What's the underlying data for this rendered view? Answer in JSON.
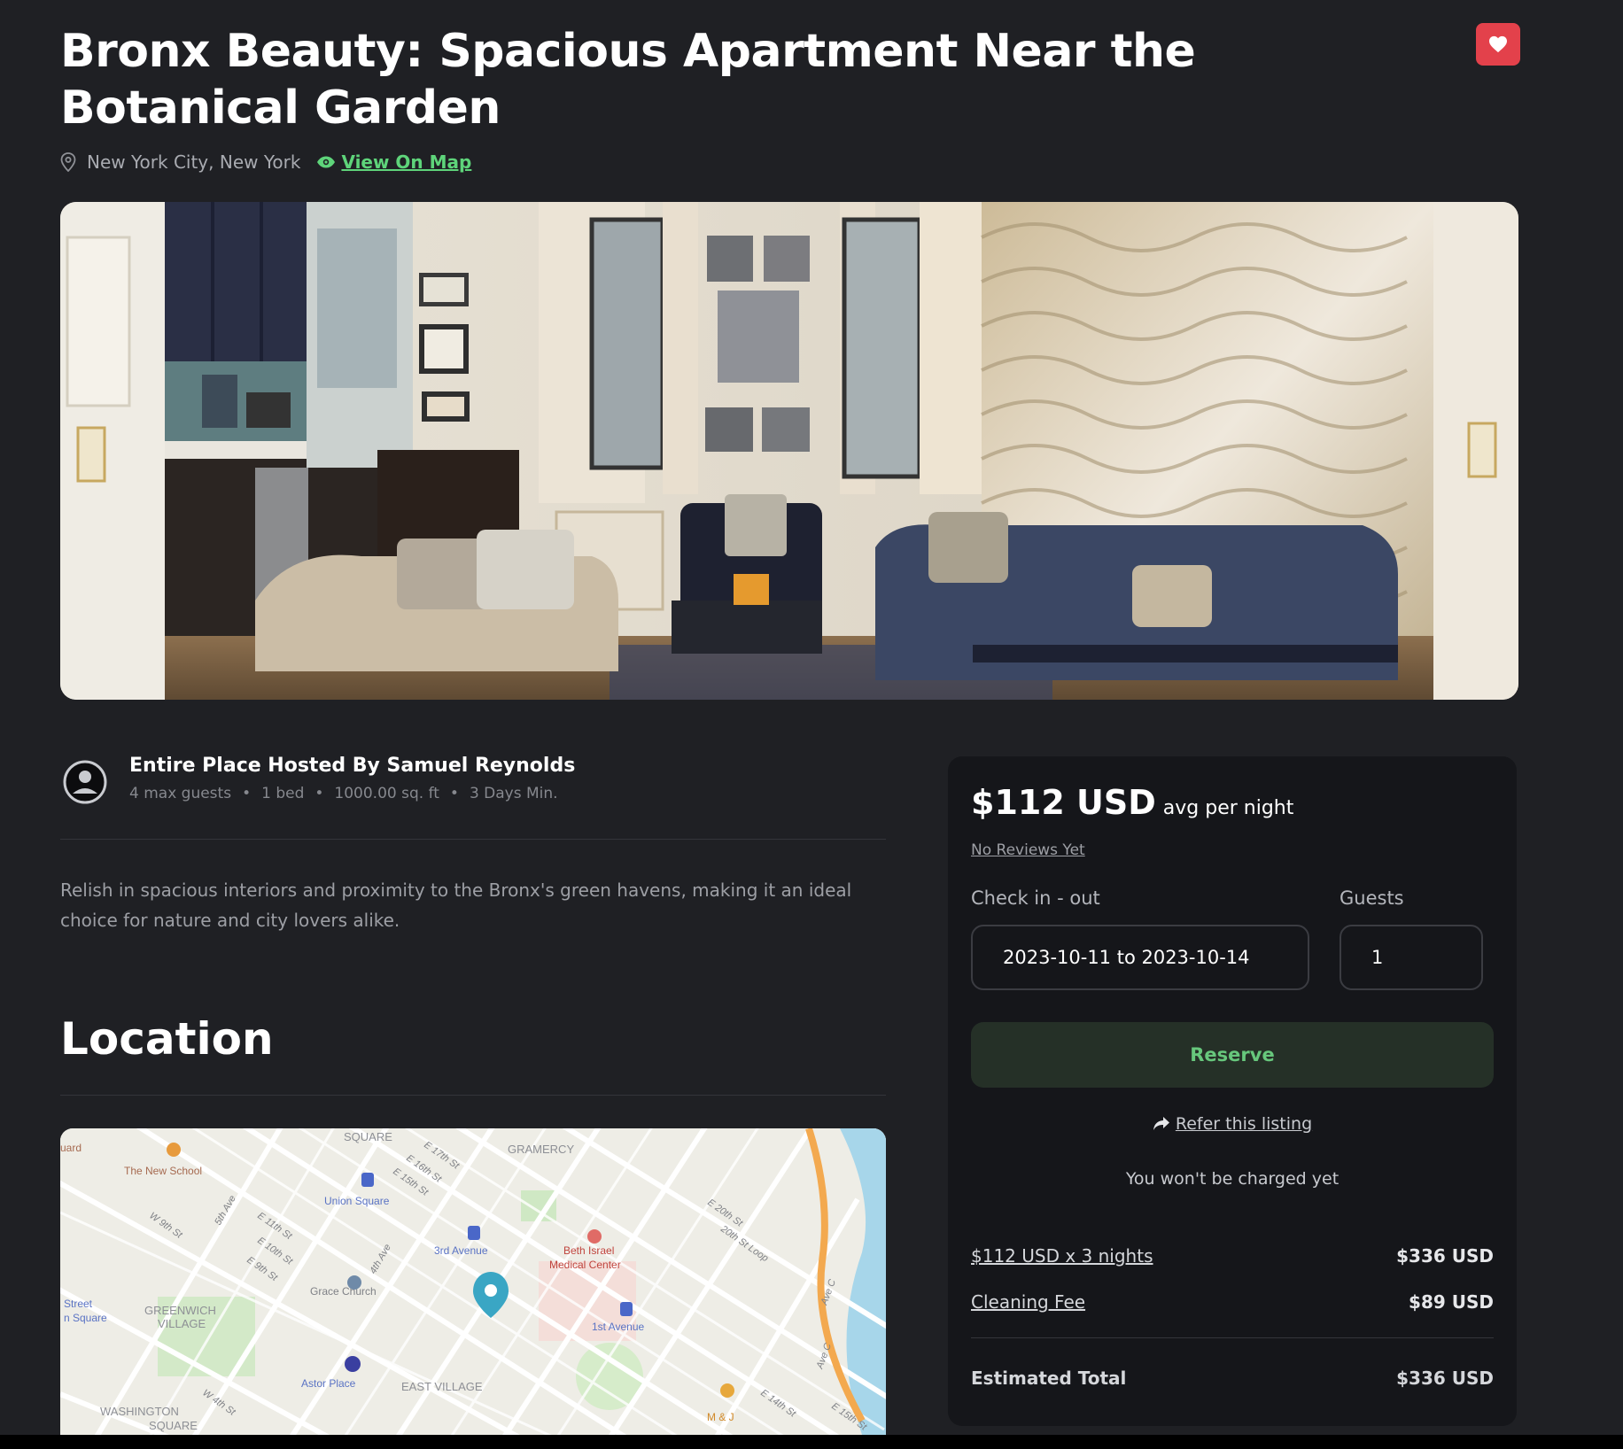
{
  "listing": {
    "title": "Bronx Beauty: Spacious Apartment Near the Botanical Garden",
    "location": "New York City, New York",
    "view_on_map": "View On Map"
  },
  "icons": {
    "favorite": "heart-icon",
    "location": "map-pin-icon",
    "view_map": "eye-icon",
    "host": "user-avatar-icon",
    "refer": "share-arrow-icon"
  },
  "colors": {
    "background": "#1f2024",
    "card": "#15161a",
    "accent_green": "#5ed47a",
    "favorite_red": "#e3414b",
    "reserve_bg": "#253027"
  },
  "host": {
    "headline": "Entire Place Hosted By Samuel Reynolds",
    "specs": [
      "4 max guests",
      "1 bed",
      "1000.00 sq. ft",
      "3 Days Min."
    ]
  },
  "description": "Relish in spacious interiors and proximity to the Bronx's green havens, making it an ideal choice for nature and city lovers alike.",
  "location_section": {
    "heading": "Location",
    "map_labels": {
      "square": "SQUARE",
      "gramercy": "GRAMERCY",
      "new_school": "The New School",
      "union_square": "Union Square",
      "third_ave": "3rd Avenue",
      "beth_israel": "Beth Israel",
      "medical_center": "Medical Center",
      "greenwich": "GREENWICH",
      "village": "VILLAGE",
      "grace_church": "Grace Church",
      "first_ave": "1st Avenue",
      "astor_place": "Astor Place",
      "east_village": "EAST VILLAGE",
      "washington": "WASHINGTON",
      "square2": "SQUARE",
      "w_9th": "W 9th St",
      "fifth_ave": "5th Ave",
      "e_11th": "E 11th St",
      "e_10th": "E 10th St",
      "e_9th": "E 9th St",
      "fourth_ave": "4th Ave",
      "e_17th": "E 17th St",
      "e_16th": "E 16th St",
      "e_15th": "E 15th St",
      "e_20th": "E 20th St",
      "st_loop": "20th St Loop",
      "ave_c": "Ave C",
      "ave_c2": "Ave C",
      "e_14th": "E 14th St",
      "e_15th_b": "E 15th St",
      "w_4th": "W 4th St",
      "mj": "M & J",
      "street": "Street",
      "n_square": "n Square",
      "uard": "uard"
    }
  },
  "booking": {
    "price": "$112 USD",
    "price_suffix": "avg per night",
    "reviews": "No Reviews Yet",
    "checkin_label": "Check in - out",
    "guests_label": "Guests",
    "dates_value": "2023-10-11 to 2023-10-14",
    "guests_value": "1",
    "reserve_label": "Reserve",
    "refer_label": "Refer this listing",
    "no_charge": "You won't be charged yet",
    "line_items": [
      {
        "label": "$112 USD x 3 nights",
        "value": "$336 USD"
      },
      {
        "label": "Cleaning Fee",
        "value": "$89 USD"
      }
    ],
    "total_label": "Estimated Total",
    "total_value": "$336 USD"
  }
}
